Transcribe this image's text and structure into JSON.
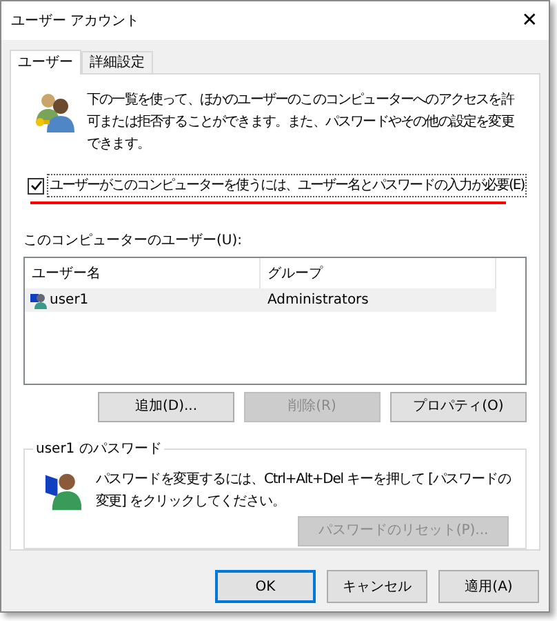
{
  "window": {
    "title": "ユーザー アカウント",
    "close": "✕"
  },
  "tabs": [
    {
      "label": "ユーザー",
      "selected": true
    },
    {
      "label": "詳細設定",
      "selected": false
    }
  ],
  "intro": "下の一覧を使って、ほかのユーザーのこのコンピューターへのアクセスを許可または拒否することができます。また、パスワードやその他の設定を変更できます。",
  "require_login": {
    "label": "ユーザーがこのコンピューターを使うには、ユーザー名とパスワードの入力が必要(E)",
    "checked": true
  },
  "users": {
    "label": "このコンピューターのユーザー(U):",
    "columns": [
      "ユーザー名",
      "グループ"
    ],
    "rows": [
      {
        "name": "user1",
        "group": "Administrators",
        "selected": true
      }
    ]
  },
  "user_buttons": [
    {
      "label": "追加(D)...",
      "disabled": false
    },
    {
      "label": "削除(R)",
      "disabled": true
    },
    {
      "label": "プロパティ(O)",
      "disabled": false
    }
  ],
  "password": {
    "title": "user1 のパスワード",
    "text": "パスワードを変更するには、Ctrl+Alt+Del キーを押して [パスワードの変更] をクリックしてください。",
    "reset": {
      "label": "パスワードのリセット(P)...",
      "disabled": true
    }
  },
  "buttons": [
    {
      "label": "OK",
      "default": true
    },
    {
      "label": "キャンセル",
      "default": false
    },
    {
      "label": "適用(A)",
      "default": false
    }
  ]
}
